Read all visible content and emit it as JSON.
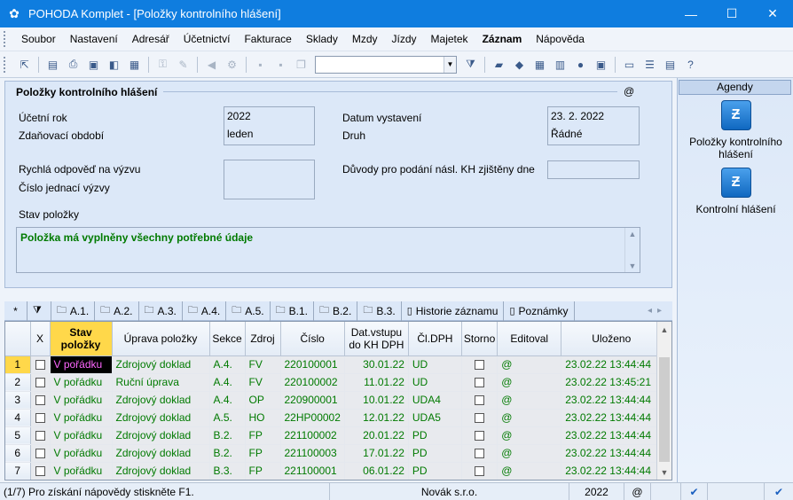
{
  "window": {
    "title": "POHODA Komplet - [Položky kontrolního hlášení]",
    "minimize": "—",
    "maximize": "☐",
    "close": "✕"
  },
  "menu": [
    "Soubor",
    "Nastavení",
    "Adresář",
    "Účetnictví",
    "Fakturace",
    "Sklady",
    "Mzdy",
    "Jízdy",
    "Majetek",
    "Záznam",
    "Nápověda"
  ],
  "form": {
    "title": "Položky kontrolního hlášení",
    "at_symbol": "@",
    "ucetni_rok_label": "Účetní rok",
    "ucetni_rok_value": "2022",
    "zdanovaci_obdobi_label": "Zdaňovací období",
    "zdanovaci_obdobi_value": "leden",
    "datum_vystaveni_label": "Datum vystavení",
    "datum_vystaveni_value": "23. 2. 2022",
    "druh_label": "Druh",
    "druh_value": "Řádné",
    "rychla_odpoved_label": "Rychlá odpověď na výzvu",
    "cislo_jednaci_label": "Číslo jednací výzvy",
    "duvody_label": "Důvody pro podání násl. KH zjištěny dne",
    "stav_polozky_label": "Stav položky",
    "stav_polozky_value": "Položka má vyplněny všechny potřebné údaje"
  },
  "agendy": {
    "title": "Agendy",
    "items": [
      {
        "label": "Položky kontrolního hlášení"
      },
      {
        "label": "Kontrolní hlášení"
      }
    ]
  },
  "tabs": [
    {
      "label": "*"
    },
    {
      "label": ""
    },
    {
      "label": "A.1."
    },
    {
      "label": "A.2."
    },
    {
      "label": "A.3."
    },
    {
      "label": "A.4."
    },
    {
      "label": "A.5."
    },
    {
      "label": "B.1."
    },
    {
      "label": "B.2."
    },
    {
      "label": "B.3."
    },
    {
      "label": "Historie záznamu"
    },
    {
      "label": "Poznámky"
    }
  ],
  "grid": {
    "columns": [
      "",
      "X",
      "Stav položky",
      "Úprava položky",
      "Sekce",
      "Zdroj",
      "Číslo",
      "Dat.vstupu do KH DPH",
      "Čl.DPH",
      "Storno",
      "Editoval",
      "Uloženo"
    ],
    "rows": [
      {
        "n": "1",
        "stav": "V pořádku",
        "uprava": "Zdrojový doklad",
        "sekce": "A.4.",
        "zdroj": "FV",
        "cislo": "220100001",
        "datum": "30.01.22",
        "cl": "UD",
        "editoval": "@",
        "ulozeno": "23.02.22 13:44:44"
      },
      {
        "n": "2",
        "stav": "V pořádku",
        "uprava": "Ruční úprava",
        "sekce": "A.4.",
        "zdroj": "FV",
        "cislo": "220100002",
        "datum": "11.01.22",
        "cl": "UD",
        "editoval": "@",
        "ulozeno": "23.02.22 13:45:21"
      },
      {
        "n": "3",
        "stav": "V pořádku",
        "uprava": "Zdrojový doklad",
        "sekce": "A.4.",
        "zdroj": "OP",
        "cislo": "220900001",
        "datum": "10.01.22",
        "cl": "UDA4",
        "editoval": "@",
        "ulozeno": "23.02.22 13:44:44"
      },
      {
        "n": "4",
        "stav": "V pořádku",
        "uprava": "Zdrojový doklad",
        "sekce": "A.5.",
        "zdroj": "HO",
        "cislo": "22HP00002",
        "datum": "12.01.22",
        "cl": "UDA5",
        "editoval": "@",
        "ulozeno": "23.02.22 13:44:44"
      },
      {
        "n": "5",
        "stav": "V pořádku",
        "uprava": "Zdrojový doklad",
        "sekce": "B.2.",
        "zdroj": "FP",
        "cislo": "221100002",
        "datum": "20.01.22",
        "cl": "PD",
        "editoval": "@",
        "ulozeno": "23.02.22 13:44:44"
      },
      {
        "n": "6",
        "stav": "V pořádku",
        "uprava": "Zdrojový doklad",
        "sekce": "B.2.",
        "zdroj": "FP",
        "cislo": "221100003",
        "datum": "17.01.22",
        "cl": "PD",
        "editoval": "@",
        "ulozeno": "23.02.22 13:44:44"
      },
      {
        "n": "7",
        "stav": "V pořádku",
        "uprava": "Zdrojový doklad",
        "sekce": "B.3.",
        "zdroj": "FP",
        "cislo": "221100001",
        "datum": "06.01.22",
        "cl": "PD",
        "editoval": "@",
        "ulozeno": "23.02.22 13:44:44"
      }
    ]
  },
  "status": {
    "help": "(1/7) Pro získání nápovědy stiskněte F1.",
    "company": "Novák s.r.o.",
    "year": "2022",
    "at": "@"
  },
  "colors": {
    "titlebar": "#0f7ddf",
    "ok_text": "#007a00",
    "header_highlight": "#ffd84a"
  }
}
